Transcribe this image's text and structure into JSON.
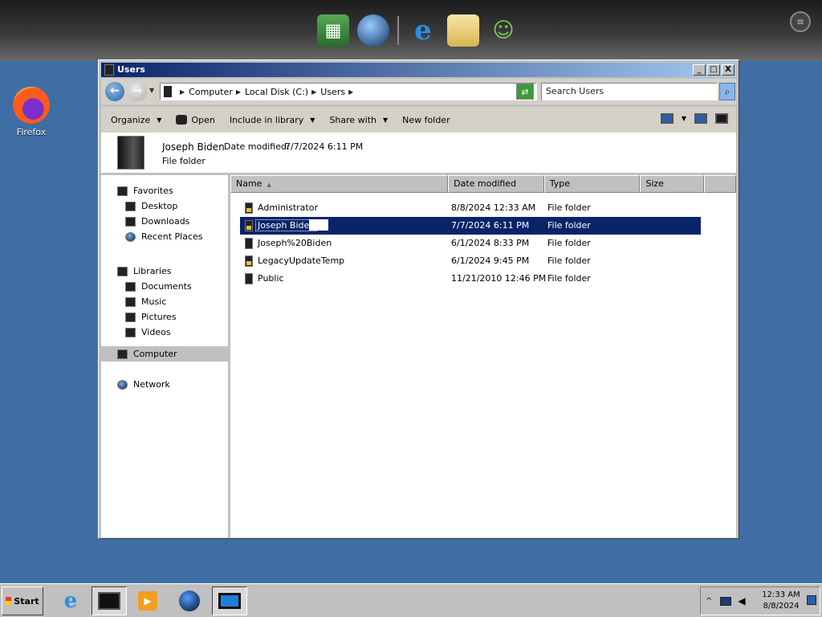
{
  "desktop": {
    "icons": [
      {
        "label": "Firefox",
        "icon": "firefox-icon"
      }
    ]
  },
  "dock": {
    "items": [
      "spreadsheet-icon",
      "globe-download-icon",
      "internet-explorer-icon",
      "mail-icon",
      "people-icon"
    ]
  },
  "window": {
    "title": "Users",
    "controls": [
      "_",
      "□",
      "X"
    ]
  },
  "address": {
    "crumbs": [
      "Computer",
      "Local Disk (C:)",
      "Users"
    ],
    "search_placeholder": "Search Users"
  },
  "toolbar": {
    "organize": "Organize",
    "open": "Open",
    "include": "Include in library",
    "share": "Share with",
    "new_folder": "New folder"
  },
  "details": {
    "name": "Joseph Biden",
    "modified_label": "Date modified:",
    "modified_value": "7/7/2024 6:11 PM",
    "type": "File folder"
  },
  "nav": {
    "favorites": "Favorites",
    "favorites_items": [
      "Desktop",
      "Downloads",
      "Recent Places"
    ],
    "libraries": "Libraries",
    "libraries_items": [
      "Documents",
      "Music",
      "Pictures",
      "Videos"
    ],
    "computer": "Computer",
    "network": "Network"
  },
  "columns": {
    "name": "Name",
    "date": "Date modified",
    "type": "Type",
    "size": "Size"
  },
  "files": [
    {
      "name": "Administrator",
      "date": "8/8/2024 12:33 AM",
      "type": "File folder"
    },
    {
      "name": "Joseph Biden",
      "date": "7/7/2024 6:11 PM",
      "type": "File folder"
    },
    {
      "name": "Joseph%20Biden",
      "date": "6/1/2024 8:33 PM",
      "type": "File folder"
    },
    {
      "name": "LegacyUpdateTemp",
      "date": "6/1/2024 9:45 PM",
      "type": "File folder"
    },
    {
      "name": "Public",
      "date": "11/21/2010 12:46 PM",
      "type": "File folder"
    }
  ],
  "taskbar": {
    "start": "Start",
    "time": "12:33 AM",
    "date": "8/8/2024"
  }
}
